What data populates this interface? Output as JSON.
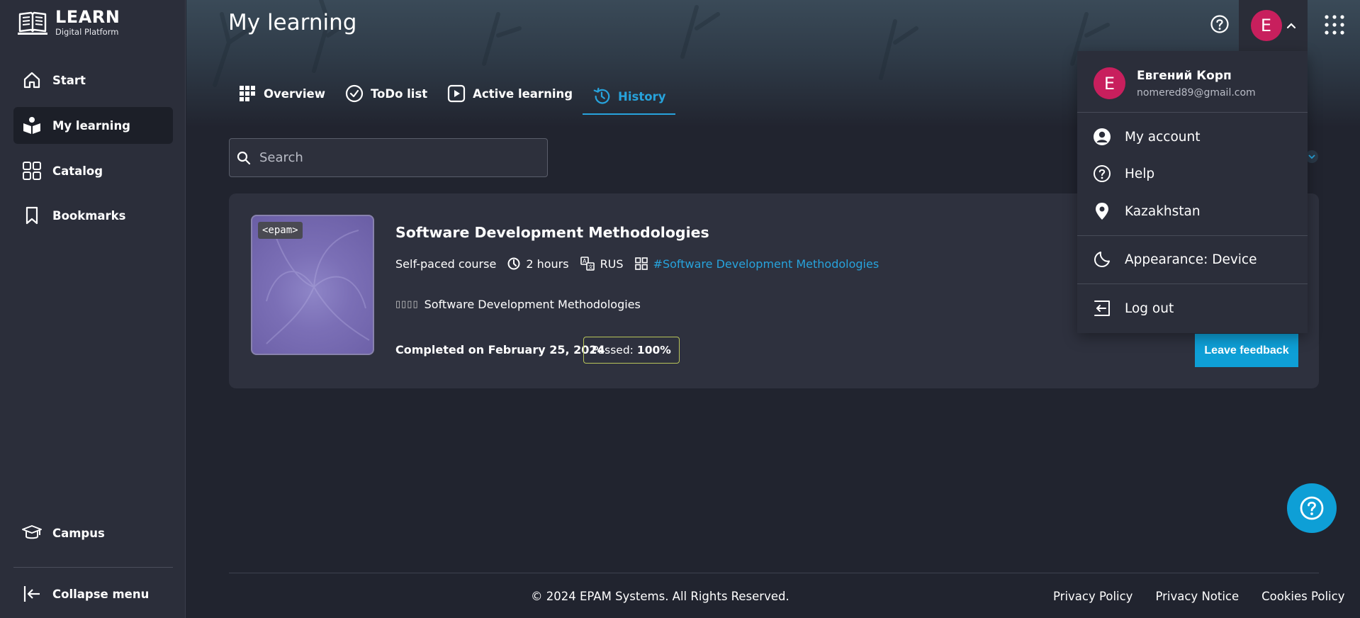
{
  "brand": {
    "title": "LEARN",
    "subtitle": "Digital Platform"
  },
  "sidebar": {
    "items": [
      {
        "label": "Start",
        "icon": "home-icon"
      },
      {
        "label": "My learning",
        "icon": "learning-icon",
        "active": true
      },
      {
        "label": "Catalog",
        "icon": "catalog-icon"
      },
      {
        "label": "Bookmarks",
        "icon": "bookmark-icon"
      }
    ],
    "bottom": [
      {
        "label": "Campus",
        "icon": "campus-icon"
      },
      {
        "label": "Collapse menu",
        "icon": "collapse-icon"
      }
    ]
  },
  "header": {
    "title": "My learning"
  },
  "user": {
    "initial": "E",
    "name": "Евгений Корп",
    "email": "nomered89@gmail.com"
  },
  "tabs": [
    {
      "label": "Overview",
      "icon": "grid-icon"
    },
    {
      "label": "ToDo list",
      "icon": "check-circle-icon"
    },
    {
      "label": "Active learning",
      "icon": "play-icon"
    },
    {
      "label": "History",
      "icon": "history-icon",
      "active": true
    }
  ],
  "search": {
    "placeholder": "Search"
  },
  "course": {
    "badge": "<epam>",
    "title": "Software Development Methodologies",
    "type": "Self-paced course",
    "duration": "2 hours",
    "language": "RUS",
    "tag": "#Software Development Methodologies",
    "provider_boxes": "▯▯▯▯",
    "provider": "Software Development Methodologies",
    "completed": "Completed on February 25, 2024",
    "passed_label": "Passed:",
    "passed_value": "100%",
    "feedback_button": "Leave feedback"
  },
  "dropdown": {
    "items": [
      {
        "label": "My account",
        "icon": "account-icon"
      },
      {
        "label": "Help",
        "icon": "help-icon"
      },
      {
        "label": "Kazakhstan",
        "icon": "location-pin-icon"
      },
      {
        "label": "Appearance: Device",
        "icon": "moon-icon"
      },
      {
        "label": "Log out",
        "icon": "logout-icon"
      }
    ]
  },
  "footer": {
    "copyright": "© 2024 EPAM Systems. All Rights Reserved.",
    "links": [
      "Privacy Policy",
      "Privacy Notice",
      "Cookies Policy"
    ]
  },
  "colors": {
    "accent": "#27a3dc",
    "avatar": "#c81f5d",
    "button": "#0e9fd6",
    "background": "#21242f"
  }
}
